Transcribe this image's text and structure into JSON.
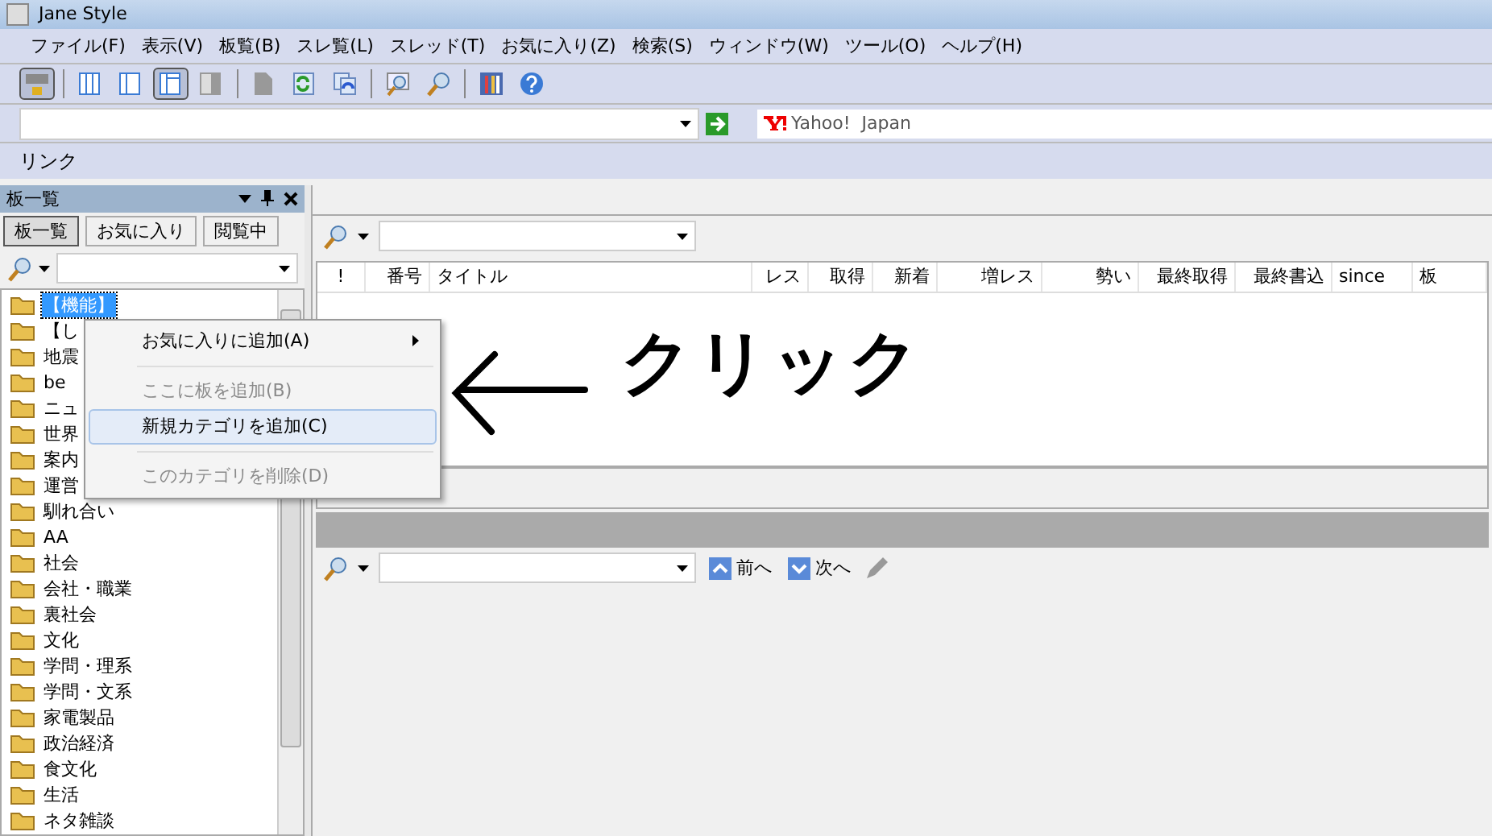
{
  "window": {
    "title": "Jane Style"
  },
  "menu_bar": [
    "ファイル(F)",
    "表示(V)",
    "板覧(B)",
    "スレ覧(L)",
    "スレッド(T)",
    "お気に入り(Z)",
    "検索(S)",
    "ウィンドウ(W)",
    "ツール(O)",
    "ヘルプ(H)"
  ],
  "toolbar": [
    {
      "kind": "network",
      "pressed": true
    },
    {
      "kind": "separator"
    },
    {
      "kind": "pane3",
      "pressed": false
    },
    {
      "kind": "pane2",
      "pressed": false
    },
    {
      "kind": "pane-left",
      "pressed": true
    },
    {
      "kind": "pane-right",
      "pressed": false
    },
    {
      "kind": "separator"
    },
    {
      "kind": "page",
      "pressed": false
    },
    {
      "kind": "refresh",
      "pressed": false
    },
    {
      "kind": "refresh-all",
      "pressed": false
    },
    {
      "kind": "separator"
    },
    {
      "kind": "search-window",
      "pressed": false
    },
    {
      "kind": "search",
      "pressed": false
    },
    {
      "kind": "separator"
    },
    {
      "kind": "tools",
      "pressed": false
    },
    {
      "kind": "help",
      "pressed": false
    }
  ],
  "link_bar": {
    "label": "リンク",
    "links": [
      "Yahoo!  Japan"
    ]
  },
  "board_panel": {
    "title": "板一覧",
    "tabs": [
      {
        "label": "板一覧",
        "selected": true
      },
      {
        "label": "お気に入り",
        "selected": false
      },
      {
        "label": "閲覧中",
        "selected": false
      }
    ],
    "items": [
      {
        "label": "【機能】",
        "selected": true
      },
      {
        "label": "【し",
        "selected": false
      },
      {
        "label": "地震",
        "selected": false
      },
      {
        "label": "be",
        "selected": false
      },
      {
        "label": "ニュ",
        "selected": false
      },
      {
        "label": "世界",
        "selected": false
      },
      {
        "label": "案内",
        "selected": false
      },
      {
        "label": "運営",
        "selected": false
      },
      {
        "label": "馴れ合い",
        "selected": false
      },
      {
        "label": "AA",
        "selected": false
      },
      {
        "label": "社会",
        "selected": false
      },
      {
        "label": "会社・職業",
        "selected": false
      },
      {
        "label": "裏社会",
        "selected": false
      },
      {
        "label": "文化",
        "selected": false
      },
      {
        "label": "学問・理系",
        "selected": false
      },
      {
        "label": "学問・文系",
        "selected": false
      },
      {
        "label": "家電製品",
        "selected": false
      },
      {
        "label": "政治経済",
        "selected": false
      },
      {
        "label": "食文化",
        "selected": false
      },
      {
        "label": "生活",
        "selected": false
      },
      {
        "label": "ネタ雑談",
        "selected": false
      }
    ]
  },
  "context_menu": [
    {
      "kind": "item",
      "label": "お気に入りに追加(A)",
      "disabled": false,
      "selected": false,
      "submenu": true
    },
    {
      "kind": "separator"
    },
    {
      "kind": "item",
      "label": "ここに板を追加(B)",
      "disabled": true,
      "selected": false,
      "submenu": false
    },
    {
      "kind": "item",
      "label": "新規カテゴリを追加(C)",
      "disabled": false,
      "selected": true,
      "submenu": false
    },
    {
      "kind": "separator"
    },
    {
      "kind": "item",
      "label": "このカテゴリを削除(D)",
      "disabled": true,
      "selected": false,
      "submenu": false
    }
  ],
  "thread_list": {
    "columns": [
      "!",
      "番号",
      "タイトル",
      "レス",
      "取得",
      "新着",
      "増レス",
      "勢い",
      "最終取得",
      "最終書込",
      "since",
      "板"
    ]
  },
  "find_bar": {
    "prev": "前へ",
    "next": "次へ"
  },
  "annotation": {
    "text": "クリック"
  }
}
